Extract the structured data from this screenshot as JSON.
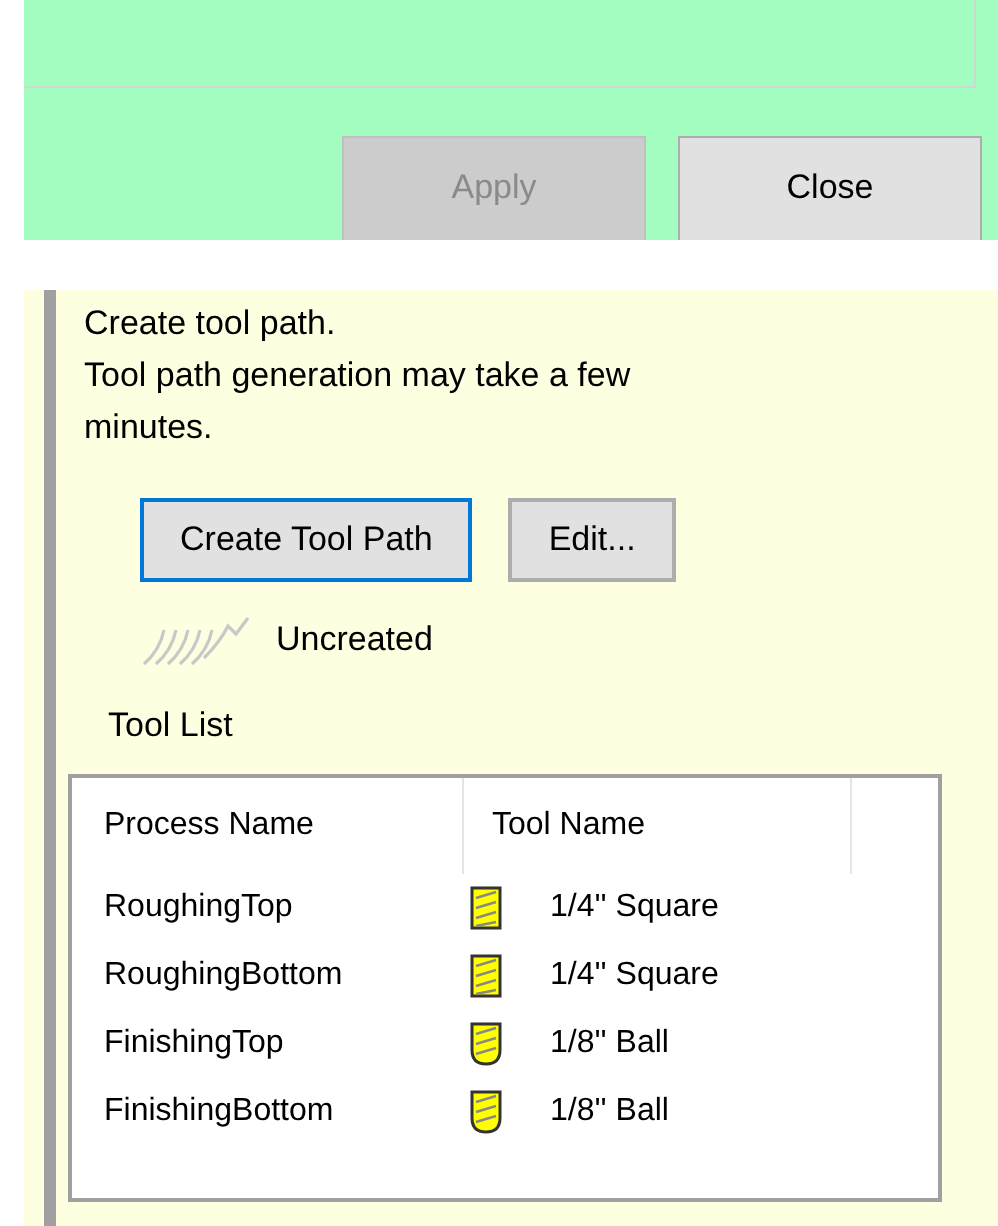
{
  "dialog_buttons": [
    {
      "label": "Apply",
      "disabled": true
    },
    {
      "label": "Close",
      "disabled": false
    }
  ],
  "tool_path": {
    "lines": [
      "Create tool path.",
      "Tool path generation may take a few minutes."
    ],
    "buttons": [
      {
        "label": "Create Tool Path",
        "focused": true
      },
      {
        "label": "Edit...",
        "focused": false
      }
    ],
    "status": "Uncreated"
  },
  "tool_list": {
    "title": "Tool List",
    "columns": [
      "Process Name",
      "Tool Name"
    ],
    "rows": [
      {
        "process": "RoughingTop",
        "tool": "1/4'' Square",
        "kind": "square"
      },
      {
        "process": "RoughingBottom",
        "tool": "1/4'' Square",
        "kind": "square"
      },
      {
        "process": "FinishingTop",
        "tool": "1/8'' Ball",
        "kind": "ball"
      },
      {
        "process": "FinishingBottom",
        "tool": "1/8'' Ball",
        "kind": "ball"
      }
    ]
  }
}
